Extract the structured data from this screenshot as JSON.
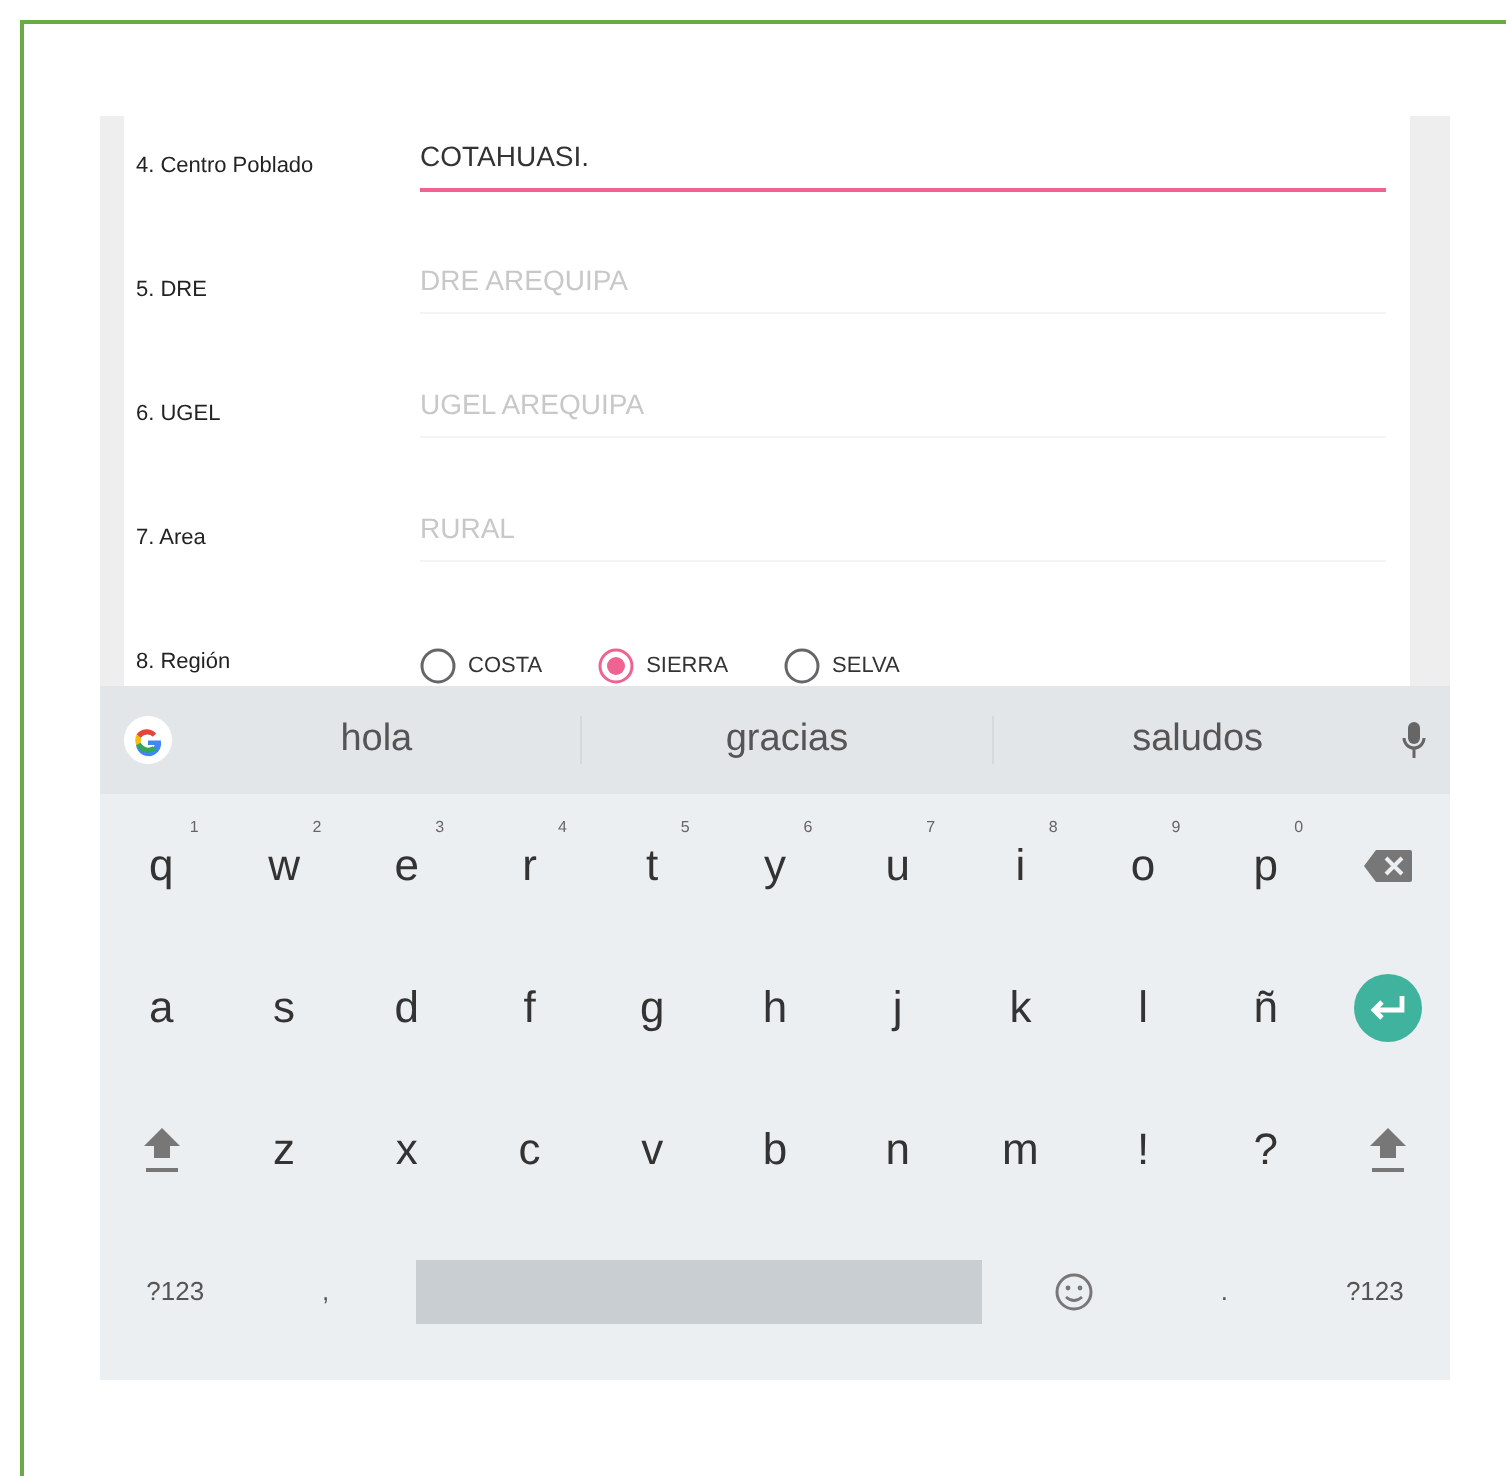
{
  "form": {
    "fields": [
      {
        "label": "4. Centro Poblado",
        "value": "COTAHUASI.",
        "focused": true,
        "disabled": false
      },
      {
        "label": "5. DRE",
        "value": "DRE AREQUIPA",
        "focused": false,
        "disabled": true
      },
      {
        "label": "6. UGEL",
        "value": "UGEL AREQUIPA",
        "focused": false,
        "disabled": true
      },
      {
        "label": "7. Area",
        "value": "RURAL",
        "focused": false,
        "disabled": true
      }
    ],
    "region": {
      "label": "8. Región",
      "options": [
        {
          "label": "COSTA",
          "selected": false
        },
        {
          "label": "SIERRA",
          "selected": true
        },
        {
          "label": "SELVA",
          "selected": false
        }
      ]
    }
  },
  "keyboard": {
    "suggestions": [
      "hola",
      "gracias",
      "saludos"
    ],
    "rows": [
      [
        {
          "kind": "letter",
          "label": "q",
          "hint": "1"
        },
        {
          "kind": "letter",
          "label": "w",
          "hint": "2"
        },
        {
          "kind": "letter",
          "label": "e",
          "hint": "3"
        },
        {
          "kind": "letter",
          "label": "r",
          "hint": "4"
        },
        {
          "kind": "letter",
          "label": "t",
          "hint": "5"
        },
        {
          "kind": "letter",
          "label": "y",
          "hint": "6"
        },
        {
          "kind": "letter",
          "label": "u",
          "hint": "7"
        },
        {
          "kind": "letter",
          "label": "i",
          "hint": "8"
        },
        {
          "kind": "letter",
          "label": "o",
          "hint": "9"
        },
        {
          "kind": "letter",
          "label": "p",
          "hint": "0"
        },
        {
          "kind": "backspace"
        }
      ],
      [
        {
          "kind": "letter",
          "label": "a"
        },
        {
          "kind": "letter",
          "label": "s"
        },
        {
          "kind": "letter",
          "label": "d"
        },
        {
          "kind": "letter",
          "label": "f"
        },
        {
          "kind": "letter",
          "label": "g"
        },
        {
          "kind": "letter",
          "label": "h"
        },
        {
          "kind": "letter",
          "label": "j"
        },
        {
          "kind": "letter",
          "label": "k"
        },
        {
          "kind": "letter",
          "label": "l"
        },
        {
          "kind": "letter",
          "label": "ñ"
        },
        {
          "kind": "enter"
        }
      ],
      [
        {
          "kind": "shift"
        },
        {
          "kind": "letter",
          "label": "z"
        },
        {
          "kind": "letter",
          "label": "x"
        },
        {
          "kind": "letter",
          "label": "c"
        },
        {
          "kind": "letter",
          "label": "v"
        },
        {
          "kind": "letter",
          "label": "b"
        },
        {
          "kind": "letter",
          "label": "n"
        },
        {
          "kind": "letter",
          "label": "m"
        },
        {
          "kind": "letter",
          "label": "!"
        },
        {
          "kind": "letter",
          "label": "?"
        },
        {
          "kind": "shift"
        }
      ],
      [
        {
          "kind": "small",
          "label": "?123"
        },
        {
          "kind": "small",
          "label": ","
        },
        {
          "kind": "space"
        },
        {
          "kind": "emoji"
        },
        {
          "kind": "small",
          "label": "."
        },
        {
          "kind": "small",
          "label": "?123"
        }
      ]
    ]
  }
}
